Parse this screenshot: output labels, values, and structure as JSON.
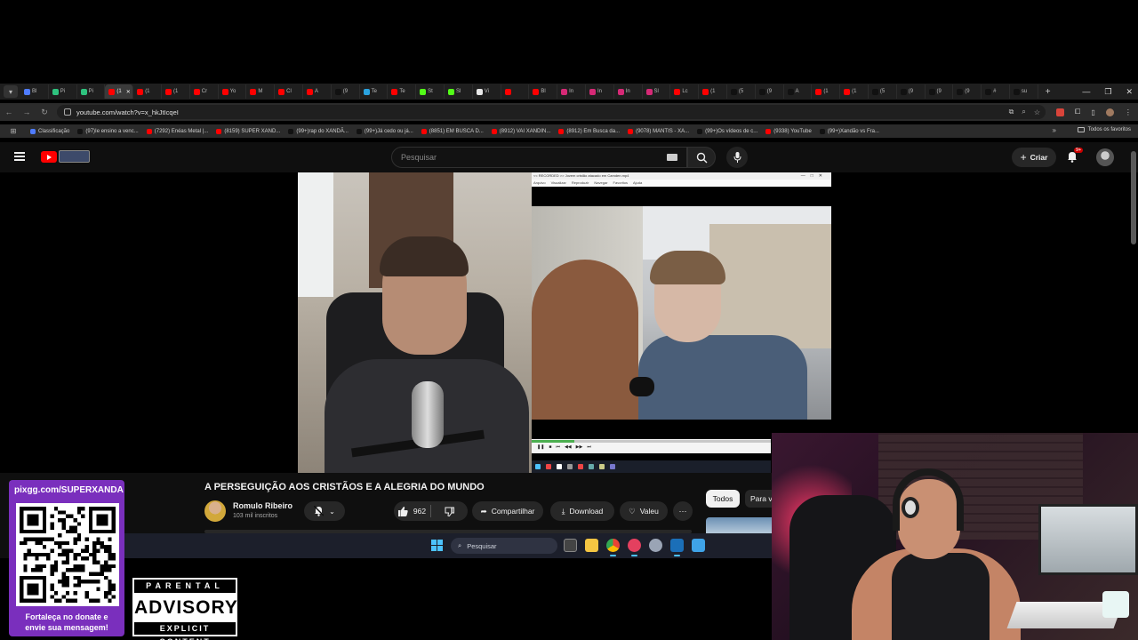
{
  "browser": {
    "tabs": [
      {
        "label": "Bl",
        "color": "#4f7cff"
      },
      {
        "label": "Pi",
        "color": "#2ec27e"
      },
      {
        "label": "Pi",
        "color": "#2ec27e"
      },
      {
        "label": "(1",
        "color": "#ff0000"
      },
      {
        "label": "(1",
        "color": "#ff0000"
      },
      {
        "label": "(1",
        "color": "#ff0000"
      },
      {
        "label": "Cr",
        "color": "#ff0000"
      },
      {
        "label": "Yo",
        "color": "#ff0000"
      },
      {
        "label": "M",
        "color": "#ff0000"
      },
      {
        "label": "Cl",
        "color": "#ff0000"
      },
      {
        "label": "A",
        "color": "#ff0000"
      },
      {
        "label": "(9",
        "color": "#111111"
      },
      {
        "label": "Te",
        "color": "#2aa3e0"
      },
      {
        "label": "Te",
        "color": "#ff0000"
      },
      {
        "label": "St",
        "color": "#53fc18"
      },
      {
        "label": "Sl",
        "color": "#53fc18"
      },
      {
        "label": "Vi",
        "color": "#e8e8e8"
      },
      {
        "label": "",
        "color": "#ff0000"
      },
      {
        "label": "Bl",
        "color": "#ff0000"
      },
      {
        "label": "In",
        "color": "#d62976"
      },
      {
        "label": "In",
        "color": "#d62976"
      },
      {
        "label": "In",
        "color": "#d62976"
      },
      {
        "label": "Sl",
        "color": "#d62976"
      },
      {
        "label": "Lc",
        "color": "#ff0000"
      },
      {
        "label": "(1",
        "color": "#ff0000"
      },
      {
        "label": "(5",
        "color": "#111111"
      },
      {
        "label": "(9",
        "color": "#111111"
      },
      {
        "label": "A",
        "color": "#111111"
      },
      {
        "label": "(1",
        "color": "#ff0000"
      },
      {
        "label": "(1",
        "color": "#ff0000"
      },
      {
        "label": "(5",
        "color": "#111111"
      },
      {
        "label": "(9",
        "color": "#111111"
      },
      {
        "label": "(9",
        "color": "#111111"
      },
      {
        "label": "(9",
        "color": "#111111"
      },
      {
        "label": "#",
        "color": "#111111"
      },
      {
        "label": "su",
        "color": "#111111"
      }
    ],
    "active_tab_index": 3,
    "url": "youtube.com/watch?v=x_hkJtIcqeI",
    "bookmarks": [
      {
        "label": "Classificação",
        "color": "#4f7cff"
      },
      {
        "label": "(97)Ie ensino a venc...",
        "color": "#111111"
      },
      {
        "label": "(7292) Enéas Metal |...",
        "color": "#ff0000"
      },
      {
        "label": "(8159) SUPER XAND...",
        "color": "#ff0000"
      },
      {
        "label": "(99+)rap do XANDÃ...",
        "color": "#111111"
      },
      {
        "label": "(99+)Já cedo ou já...",
        "color": "#111111"
      },
      {
        "label": "(8851) EM BUSCA D...",
        "color": "#ff0000"
      },
      {
        "label": "(8912) VAI XANDIN...",
        "color": "#ff0000"
      },
      {
        "label": "(8912) Em Busca da...",
        "color": "#ff0000"
      },
      {
        "label": "(9078) MANTIS - XA...",
        "color": "#ff0000"
      },
      {
        "label": "(99+)Os vídeos de c...",
        "color": "#111111"
      },
      {
        "label": "(9338) YouTube",
        "color": "#ff0000"
      },
      {
        "label": "(99+)Xandão vs Fra...",
        "color": "#111111"
      }
    ],
    "all_bookmarks_label": "Todos os favoritos"
  },
  "youtube": {
    "search_placeholder": "Pesquisar",
    "create_label": "Criar",
    "notif_count": "9+",
    "video_title": "A PERSEGUIÇÃO AOS CRISTÃOS E A ALEGRIA DO MUNDO",
    "channel_name": "Romulo Ribeiro",
    "subscribers": "103 mil inscritos",
    "likes": "962",
    "share_label": "Compartilhar",
    "download_label": "Download",
    "thanks_label": "Valeu",
    "chip_all": "Todos",
    "chip_next": "Para v",
    "player_title": "<< RECORDED >> Jovem cristão atacado em Camden.mp4",
    "player_menu": [
      "Arquivo",
      "Visualizar",
      "Reproduzir",
      "Navegar",
      "Favoritos",
      "Ajuda"
    ]
  },
  "taskbar": {
    "search_label": "Pesquisar"
  },
  "overlay": {
    "donate_url": "pixgg.com/SUPERXANDA",
    "donate_msg_line1": "Fortaleça no donate e",
    "donate_msg_line2": "envie sua mensagem!",
    "advisory_top": "PARENTAL",
    "advisory_mid": "ADVISORY",
    "advisory_bot": "EXPLICIT CONTENT"
  }
}
